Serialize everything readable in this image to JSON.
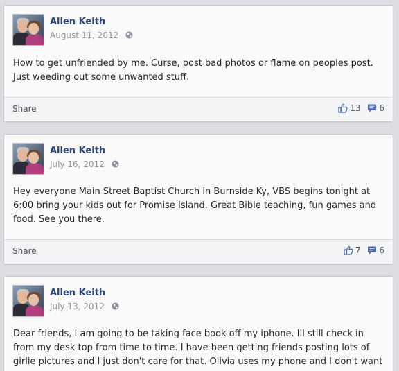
{
  "posts": [
    {
      "author": "Allen Keith",
      "date": "August 11, 2012",
      "text": "How to get unfriended by me. Curse, post bad photos or flame on peoples post. Just weeding out some unwanted stuff.",
      "share_label": "Share",
      "likes": "13",
      "comments": "6"
    },
    {
      "author": "Allen Keith",
      "date": "July 16, 2012",
      "text": "Hey everyone Main Street Baptist Church in Burnside Ky, VBS begins tonight at 6:00 bring your kids out for Promise Island. Great Bible teaching, fun games and food. See you there.",
      "share_label": "Share",
      "likes": "7",
      "comments": "6"
    },
    {
      "author": "Allen Keith",
      "date": "July 13, 2012",
      "text": "Dear friends, I am going to be taking face book off my iphone. Ill still check in from my desk top from time to time. I have been getting friends posting lots of girlie pictures and I just don't care for that. Olivia uses my phone and I don't want to try to explain those"
    }
  ],
  "icons": {
    "privacy": "globe-icon",
    "like": "thumbs-up-icon",
    "comment": "comment-icon"
  },
  "colors": {
    "name": "#2f467b",
    "meta": "#8d939e",
    "icon_blue": "#4b6aa8"
  }
}
